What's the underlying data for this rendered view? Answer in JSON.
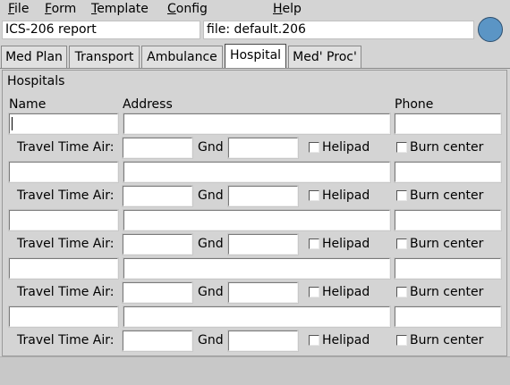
{
  "menu": {
    "file": {
      "first": "F",
      "rest": "ile"
    },
    "form": {
      "first": "F",
      "rest": "orm"
    },
    "template": {
      "first": "T",
      "rest": "emplate"
    },
    "config": {
      "first": "C",
      "rest": "onfig"
    },
    "help": {
      "first": "H",
      "rest": "elp"
    }
  },
  "header": {
    "report_name": "ICS-206 report",
    "file_label": "file:",
    "file_name": "default.206"
  },
  "tabs": [
    {
      "label": "Med Plan"
    },
    {
      "label": "Transport"
    },
    {
      "label": "Ambulance"
    },
    {
      "label": "Hospital",
      "active": true
    },
    {
      "label": "Med' Proc'"
    }
  ],
  "hospitals": {
    "section_title": "Hospitals",
    "col_name": "Name",
    "col_address": "Address",
    "col_phone": "Phone",
    "travel_air_label": "Travel Time Air:",
    "gnd_label": "Gnd",
    "helipad_label": "Helipad",
    "burn_label": "Burn center",
    "rows": [
      {
        "name": "",
        "address": "",
        "phone": "",
        "air": "",
        "gnd": "",
        "helipad": false,
        "burn": false
      },
      {
        "name": "",
        "address": "",
        "phone": "",
        "air": "",
        "gnd": "",
        "helipad": false,
        "burn": false
      },
      {
        "name": "",
        "address": "",
        "phone": "",
        "air": "",
        "gnd": "",
        "helipad": false,
        "burn": false
      },
      {
        "name": "",
        "address": "",
        "phone": "",
        "air": "",
        "gnd": "",
        "helipad": false,
        "burn": false
      },
      {
        "name": "",
        "address": "",
        "phone": "",
        "air": "",
        "gnd": "",
        "helipad": false,
        "burn": false
      }
    ]
  },
  "colors": {
    "background": "#d4d4d4",
    "active_tab": "#ffffff",
    "status_indicator": "#5b95c5"
  }
}
